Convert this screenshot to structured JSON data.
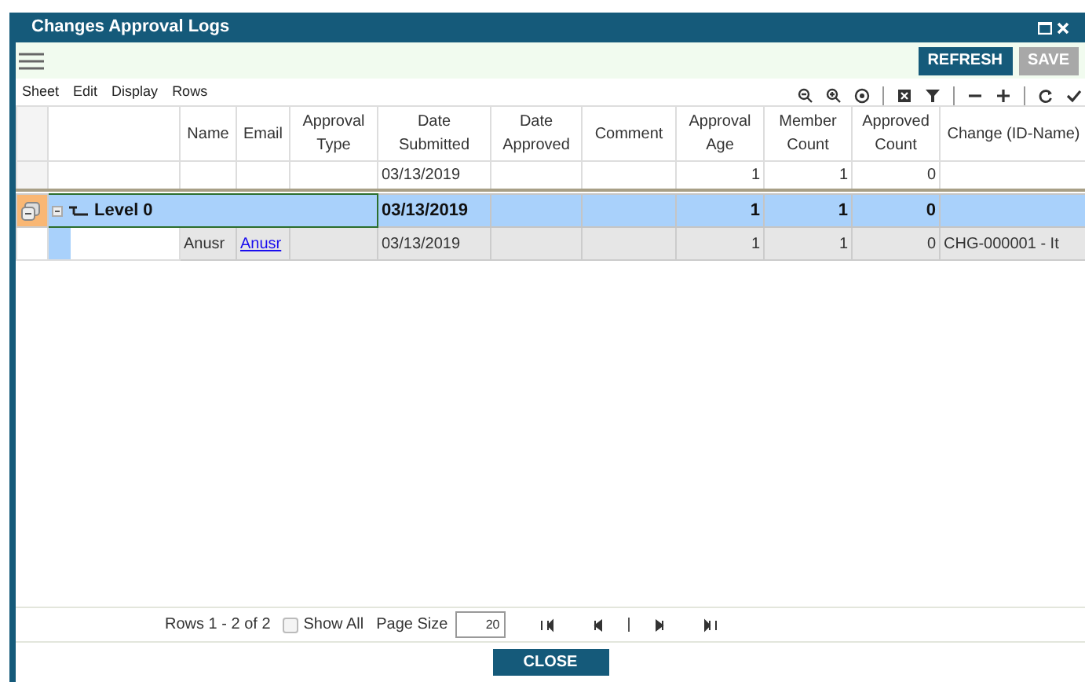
{
  "window": {
    "title": "Changes Approval Logs"
  },
  "toolbar": {
    "buttons": [
      {
        "label": "REFRESH",
        "disabled": false
      },
      {
        "label": "SAVE",
        "disabled": true
      }
    ]
  },
  "menu": [
    "Sheet",
    "Edit",
    "Display",
    "Rows"
  ],
  "columns": [
    "Name",
    "Email",
    "Approval Type",
    "Date Submitted",
    "Date Approved",
    "Comment",
    "Approval Age",
    "Member Count",
    "Approved Count",
    "Change (ID-Name)"
  ],
  "summary_row": {
    "date_submitted": "03/13/2019",
    "approval_age": "1",
    "member_count": "1",
    "approved_count": "0"
  },
  "rows": [
    {
      "kind": "group",
      "label": "Level 0",
      "expanded": true,
      "selected": true,
      "cells": {
        "date_submitted": "03/13/2019",
        "approval_age": "1",
        "member_count": "1",
        "approved_count": "0"
      }
    },
    {
      "kind": "data",
      "selected": false,
      "cells": {
        "name": "Anusr",
        "email": "Anusr",
        "date_submitted": "03/13/2019",
        "approval_age": "1",
        "member_count": "1",
        "approved_count": "0",
        "change": "CHG-000001 - It"
      }
    }
  ],
  "footer": {
    "rows_info": "Rows 1 - 2 of 2",
    "show_all": {
      "label": "Show All",
      "checked": false
    },
    "page_size_label": "Page Size",
    "page_size": "20"
  },
  "close_button": "CLOSE"
}
